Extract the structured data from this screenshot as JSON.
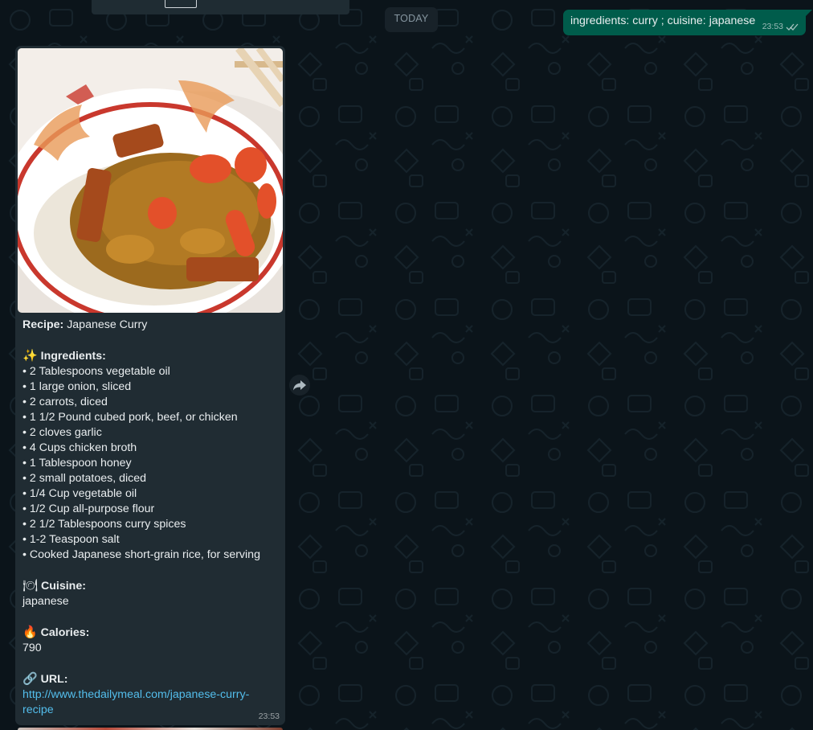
{
  "chat": {
    "date_separator": "TODAY",
    "outgoing": {
      "text": "ingredients: curry ; cuisine: japanese",
      "time": "23:53",
      "status_icon": "double-check-icon"
    },
    "incoming": {
      "image_alt": "Japanese curry served over rice",
      "recipe_label": "Recipe:",
      "recipe_name": " Japanese Curry",
      "ingredients_emoji": "✨",
      "ingredients_label": " Ingredients:",
      "ingredients": [
        "• 2 Tablespoons vegetable oil",
        "• 1 large onion, sliced",
        "• 2 carrots, diced",
        "• 1 1/2 Pound cubed pork, beef, or chicken",
        "• 2 cloves garlic",
        "• 4 Cups chicken broth",
        "• 1 Tablespoon honey",
        "• 2 small potatoes, diced",
        "• 1/4 Cup vegetable oil",
        "• 1/2 Cup all-purpose flour",
        "• 2 1/2 Tablespoons curry spices",
        "• 1-2 Teaspoon salt",
        "• Cooked Japanese short-grain rice, for serving"
      ],
      "cuisine_emoji": "🍽",
      "cuisine_label": " Cuisine:",
      "cuisine": "japanese",
      "calories_emoji": "🔥",
      "calories_label": " Calories:",
      "calories": "790",
      "url_emoji": "🔗",
      "url_label": " URL:",
      "url_line1": "http://www.thedailymeal.com/japanese-curry-",
      "url_line2": "recipe",
      "time": "23:53"
    }
  },
  "icons": {
    "forward": "forward-arrow-icon"
  },
  "colors": {
    "background": "#0b141a",
    "incoming_bubble": "#202c33",
    "outgoing_bubble": "#005c4b",
    "link": "#53bdeb"
  }
}
